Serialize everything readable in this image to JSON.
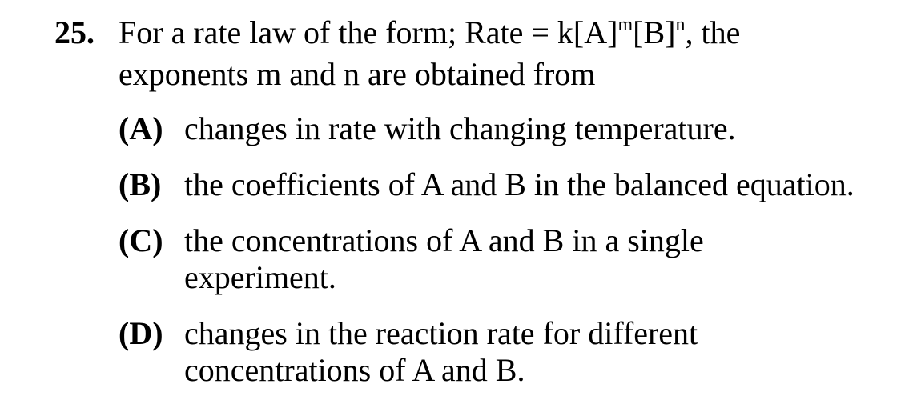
{
  "question": {
    "number": "25.",
    "stem_before": "For a rate law of the form; Rate = k[A]",
    "exp_m": "m",
    "stem_mid": "[B]",
    "exp_n": "n",
    "stem_after": ", the exponents m and n are obtained from"
  },
  "options": [
    {
      "label": "(A)",
      "text": "changes in rate with changing temperature."
    },
    {
      "label": "(B)",
      "text": "the coefficients of A and B in the balanced equation."
    },
    {
      "label": "(C)",
      "text": "the concentrations of A and B in a single experiment."
    },
    {
      "label": "(D)",
      "text": "changes in the reaction rate for different concentrations of A and B."
    }
  ]
}
